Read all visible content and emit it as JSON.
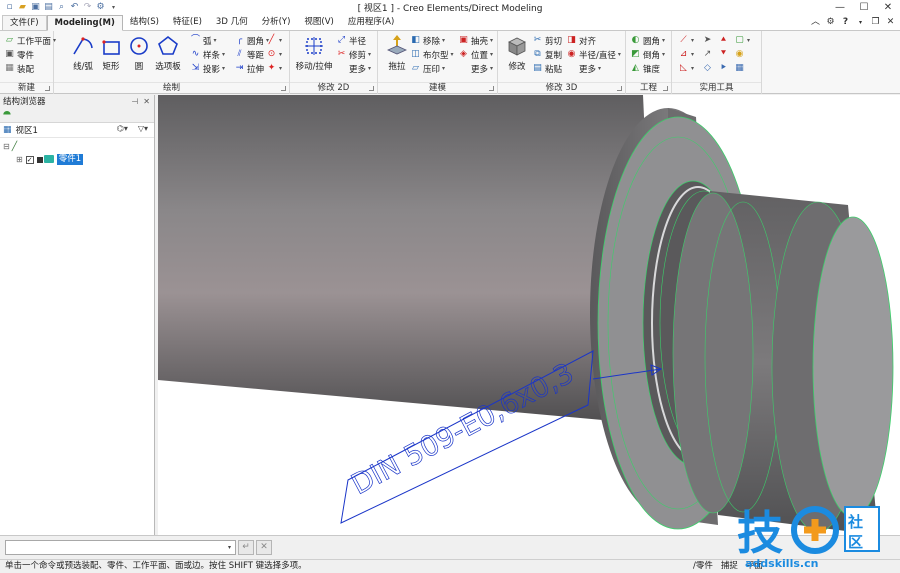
{
  "window": {
    "title": "[ 视区1 ] - Creo Elements/Direct Modeling",
    "controls": [
      "minimize-icon",
      "maximize-icon",
      "close-icon"
    ]
  },
  "quick_access": [
    "new-file-icon",
    "open-folder-icon",
    "save-icon",
    "print-preview-icon",
    "search-file-icon",
    "undo-icon",
    "redo-icon",
    "tool-settings-icon"
  ],
  "tabs": [
    {
      "label": "文件(F)"
    },
    {
      "label": "Modeling(M)"
    },
    {
      "label": "结构(S)"
    },
    {
      "label": "特征(E)"
    },
    {
      "label": "3D 几何"
    },
    {
      "label": "分析(Y)"
    },
    {
      "label": "视图(V)"
    },
    {
      "label": "应用程序(A)"
    }
  ],
  "ribbon": {
    "new_group": {
      "label": "新建",
      "items": [
        "工作平面",
        "零件",
        "装配"
      ]
    },
    "draw_group": {
      "label": "绘制",
      "big": [
        "线/弧",
        "矩形",
        "圆",
        "选项板"
      ],
      "small": [
        "弧",
        "样条",
        "投影",
        "圆角",
        "等距",
        "拉伸"
      ]
    },
    "modify2d_group": {
      "label": "修改 2D",
      "big": "移动/拉伸",
      "small": [
        "半径",
        "修剪",
        "更多"
      ]
    },
    "build_group": {
      "label": "建模",
      "big": "拖拉",
      "small": [
        "移除",
        "布尔型",
        "压印",
        "抽壳",
        "位置",
        "更多"
      ]
    },
    "modify3d_group": {
      "label": "修改 3D",
      "big": "修改",
      "small": [
        "剪切",
        "复制",
        "粘贴",
        "对齐",
        "半径/直径",
        "更多"
      ]
    },
    "eng_group": {
      "label": "工程",
      "small": [
        "圆角",
        "倒角",
        "锥度"
      ]
    },
    "util_group": {
      "label": "实用工具"
    }
  },
  "browser": {
    "title": "结构浏览器",
    "view_label": "视区1",
    "part_label": "零件1"
  },
  "viewport": {
    "annotation": "DIN 509-E0,6x0,3"
  },
  "command": {
    "input_value": ""
  },
  "status": {
    "message": "单击一个命令或预选装配、零件、工作平面、面或边。按住 SHIFT 键选择多项。",
    "part_label": "/零件",
    "snap_label": "捕捉",
    "plane_label": "平面"
  },
  "watermark": {
    "main": "技",
    "sub": "社区",
    "url": "addskills.cn"
  },
  "colors": {
    "accent_blue": "#1f7bd6",
    "annotation_blue": "#1a35c8",
    "edge_green": "#3bd06a",
    "watermark_orange": "#f39a1c",
    "watermark_blue": "#1b8be0"
  }
}
